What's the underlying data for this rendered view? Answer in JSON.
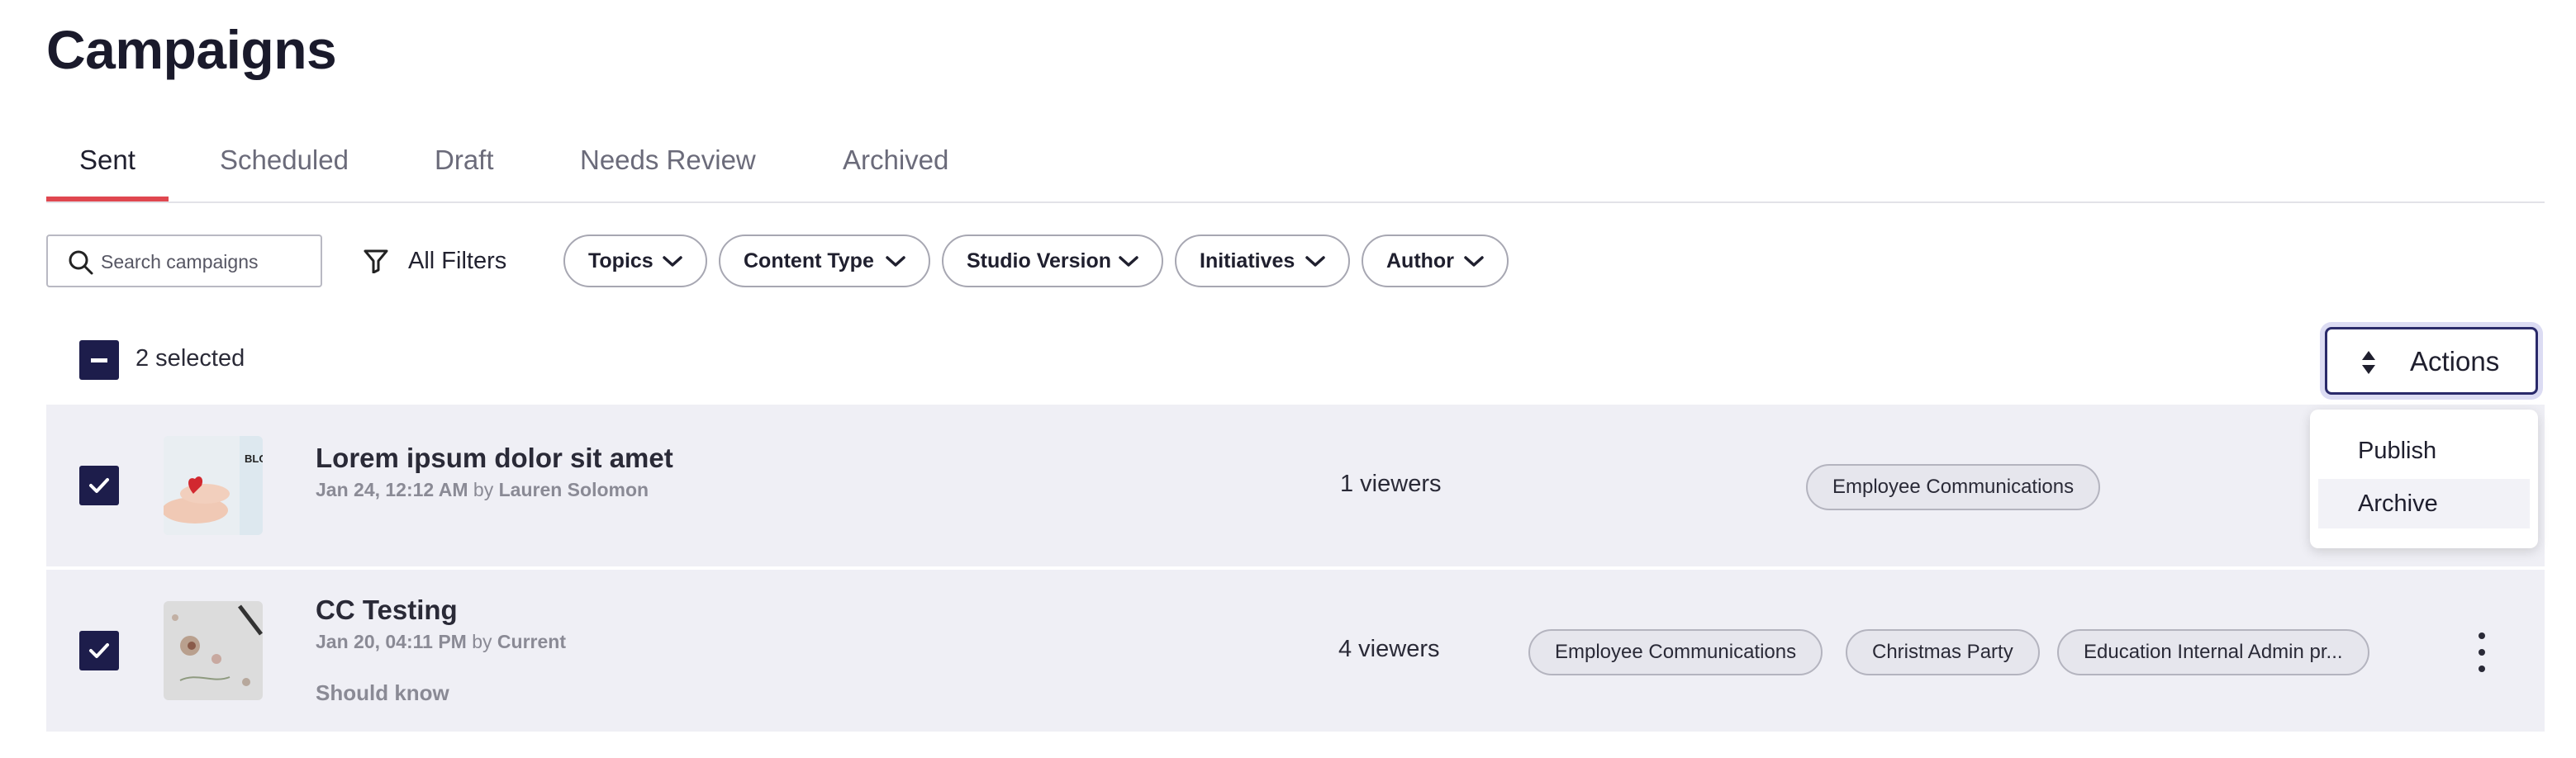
{
  "page": {
    "title": "Campaigns"
  },
  "tabs": [
    {
      "label": "Sent",
      "active": true
    },
    {
      "label": "Scheduled"
    },
    {
      "label": "Draft"
    },
    {
      "label": "Needs Review"
    },
    {
      "label": "Archived"
    }
  ],
  "filters": {
    "search_placeholder": "Search campaigns",
    "search_value": "",
    "all_filters_label": "All Filters",
    "pills": [
      "Topics",
      "Content Type",
      "Studio Version",
      "Initiatives",
      "Author"
    ]
  },
  "selection": {
    "text": "2 selected"
  },
  "actions": {
    "label": "Actions",
    "menu": [
      "Publish",
      "Archive"
    ]
  },
  "campaigns": [
    {
      "title": "Lorem ipsum dolor sit amet",
      "date": "Jan 24, 12:12 AM",
      "by": "by",
      "author": "Lauren Solomon",
      "viewers": "1 viewers",
      "tags": [
        "Employee Communications"
      ],
      "thumb_text": "BLO DRI",
      "checked": true
    },
    {
      "title": "CC Testing",
      "date": "Jan 20, 04:11 PM",
      "by": "by",
      "author": "Current",
      "extra": "Should know",
      "viewers": "4 viewers",
      "tags": [
        "Employee Communications",
        "Christmas Party",
        "Education Internal Admin pr..."
      ],
      "checked": true
    }
  ],
  "colors": {
    "accent": "#e0474f",
    "checkbox": "#1d1d4b",
    "row_bg": "#efeff5"
  }
}
